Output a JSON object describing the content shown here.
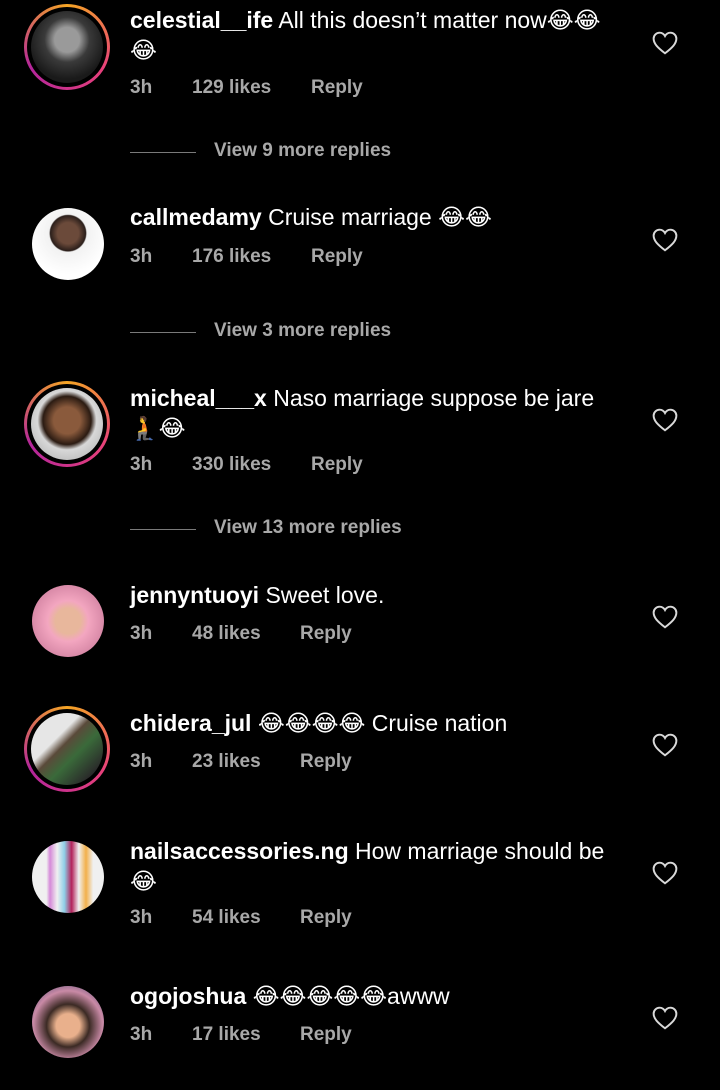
{
  "comments": [
    {
      "username": "celestial__ife",
      "text": " All this doesn’t matter now😂😂😂",
      "time": "3h",
      "likes": "129 likes",
      "reply": "Reply",
      "has_story_ring": true,
      "view_more": "View 9 more replies"
    },
    {
      "username": "callmedamy",
      "text": " Cruise marriage 😂😂",
      "time": "3h",
      "likes": "176 likes",
      "reply": "Reply",
      "has_story_ring": false,
      "view_more": "View 3 more replies"
    },
    {
      "username": "micheal___x",
      "text": " Naso marriage suppose be jare 🧎😂",
      "time": "3h",
      "likes": "330 likes",
      "reply": "Reply",
      "has_story_ring": true,
      "view_more": "View 13 more replies"
    },
    {
      "username": "jennyntuoyi",
      "text": " Sweet love.",
      "time": "3h",
      "likes": "48 likes",
      "reply": "Reply",
      "has_story_ring": false
    },
    {
      "username": "chidera_jul",
      "text": " 😂😂😂😂 Cruise nation",
      "time": "3h",
      "likes": "23 likes",
      "reply": "Reply",
      "has_story_ring": true
    },
    {
      "username": "nailsaccessories.ng",
      "text": " How marriage should be 😂",
      "time": "3h",
      "likes": "54 likes",
      "reply": "Reply",
      "has_story_ring": false
    },
    {
      "username": "ogojoshua",
      "text": " 😂😂😂😂😂awww",
      "time": "3h",
      "likes": "17 likes",
      "reply": "Reply",
      "has_story_ring": false
    }
  ],
  "icons": {
    "like": "heart-outline-icon"
  },
  "colors": {
    "background": "#000000",
    "text": "#ffffff",
    "meta": "#a8a8a8",
    "ring_start": "#f5a524",
    "ring_end": "#b3259b"
  }
}
